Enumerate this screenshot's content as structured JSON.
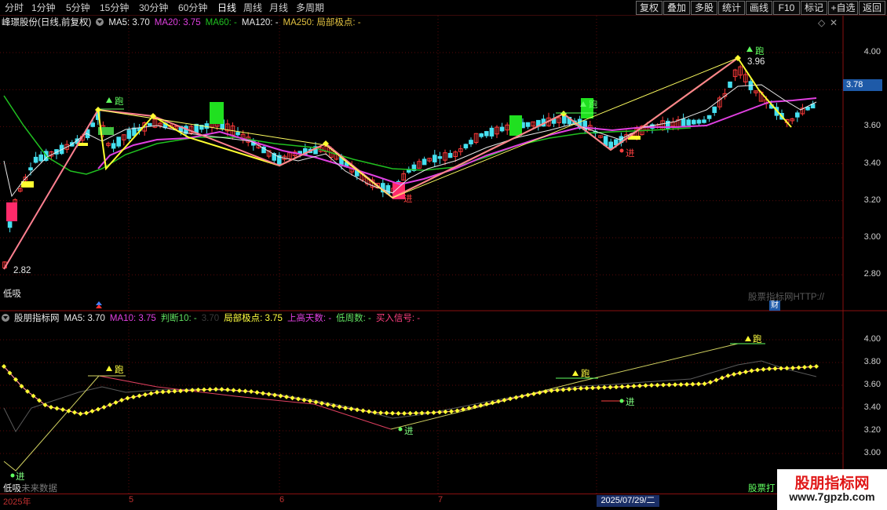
{
  "toolbar": {
    "periods": [
      "分时",
      "1分钟",
      "5分钟",
      "15分钟",
      "30分钟",
      "60分钟",
      "日线",
      "周线",
      "月线",
      "多周期"
    ],
    "active_period": "日线",
    "right_buttons": [
      "复权",
      "叠加",
      "多股",
      "统计",
      "画线",
      "F10",
      "标记",
      "+自选",
      "返回"
    ]
  },
  "main_panel": {
    "stock": "峰璟股份(日线,前复权)",
    "ma5": "MA5: 3.70",
    "ma20": "MA20: 3.75",
    "ma60": "MA60: -",
    "ma120": "MA120: -",
    "ma250": "MA250: 局部极点: -",
    "current_price": "3.78",
    "high_label": "3.96",
    "low_label": "2.82",
    "signal_run": "跑",
    "signal_in": "进",
    "low_buy": "低吸",
    "watermark": "股票指标网HTTP://",
    "cai": "财",
    "axis": [
      "4.00",
      "3.80",
      "3.60",
      "3.40",
      "3.20",
      "3.00",
      "2.80"
    ]
  },
  "indicator_panel": {
    "name": "股朋指标网",
    "ma5": "MA5: 3.70",
    "ma10": "MA10: 3.75",
    "judge10": "判断10: -",
    "judge_val": "3.70",
    "extreme": "局部极点: 3.75",
    "up_days": "上高天数: -",
    "low_week": "低周数: -",
    "buy_signal": "买入信号: -",
    "low_buy": "低吸",
    "future_data": "未来数据",
    "watermark": "股票打",
    "axis": [
      "4.00",
      "3.80",
      "3.60",
      "3.40",
      "3.20",
      "3.00"
    ]
  },
  "date_axis": {
    "year": "2025年",
    "months": [
      "5",
      "6",
      "7"
    ],
    "current_date": "2025/07/29/二"
  },
  "watermark": {
    "cn": "股朋指标网",
    "url": "www.7gpzb.com"
  },
  "colors": {
    "up": "#ff3a3a",
    "down": "#46e0f0",
    "ma_white": "#e8e8e8",
    "ma_magenta": "#e040e0",
    "ma_green": "#20c020",
    "zigzag": "#ffff30",
    "trend": "#ff8090",
    "grid": "#6a0c0c"
  }
}
